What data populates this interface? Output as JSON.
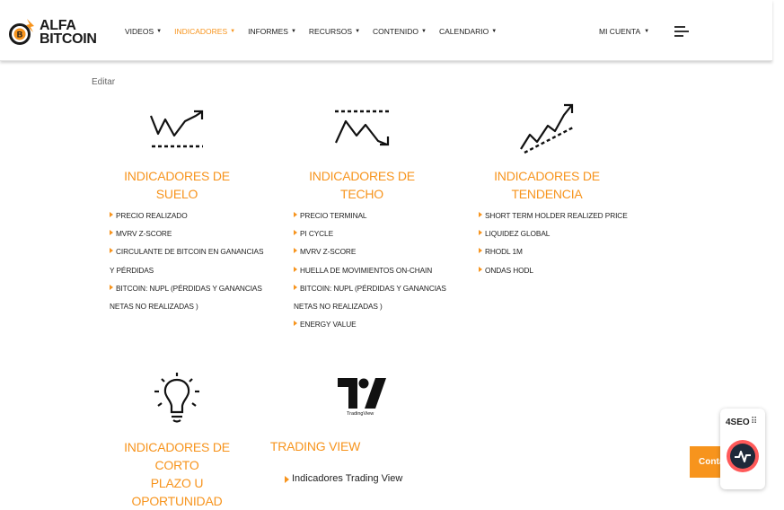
{
  "brand": {
    "line1": "ALFA",
    "line2": "BITCOIN",
    "mark": "B",
    "accent": "#f7941d"
  },
  "nav": [
    {
      "label": "VIDEOS",
      "active": false
    },
    {
      "label": "INDICADORES",
      "active": true
    },
    {
      "label": "INFORMES",
      "active": false
    },
    {
      "label": "RECURSOS",
      "active": false
    },
    {
      "label": "CONTENIDO",
      "active": false
    },
    {
      "label": "CALENDARIO",
      "active": false
    }
  ],
  "account": {
    "label": "MI CUENTA"
  },
  "edit_link": "Editar",
  "sections": {
    "suelo": {
      "icon": "floor-chart-icon",
      "title": "INDICADORES DE SUELO",
      "items": [
        "PRECIO REALIZADO",
        "MVRV Z-SCORE",
        "CIRCULANTE DE BITCOIN EN GANANCIAS",
        "Y PÉRDIDAS",
        "BITCOIN: NUPL (PÉRDIDAS Y GANANCIAS",
        "NETAS NO REALIZADAS )"
      ]
    },
    "techo": {
      "icon": "ceiling-chart-icon",
      "title": "INDICADORES DE TECHO",
      "items": [
        "PRECIO TERMINAL",
        "PI CYCLE",
        "MVRV Z-SCORE",
        "HUELLA DE MOVIMIENTOS ON-CHAIN",
        "BITCOIN: NUPL (PÉRDIDAS Y GANANCIAS",
        "NETAS NO REALIZADAS )",
        "ENERGY VALUE"
      ]
    },
    "tendencia": {
      "icon": "trend-chart-icon",
      "title": "INDICADORES DE TENDENCIA",
      "items": [
        "SHORT TERM HOLDER REALIZED PRICE",
        "LIQUIDEZ GLOBAL",
        "RHODL 1M",
        "ONDAS HODL"
      ]
    },
    "corto": {
      "icon": "lightbulb-icon",
      "title_line1": "INDICADORES DE CORTO",
      "title_line2": "PLAZO U OPORTUNIDAD"
    },
    "tradingview": {
      "icon": "tradingview-logo-icon",
      "logo_caption": "TradingView",
      "title": "TRADING VIEW",
      "link": "Indicadores Trading View"
    }
  },
  "widgets": {
    "contact_label": "Conta",
    "seo_label": "4SEO",
    "seo_dots": "⠿"
  }
}
